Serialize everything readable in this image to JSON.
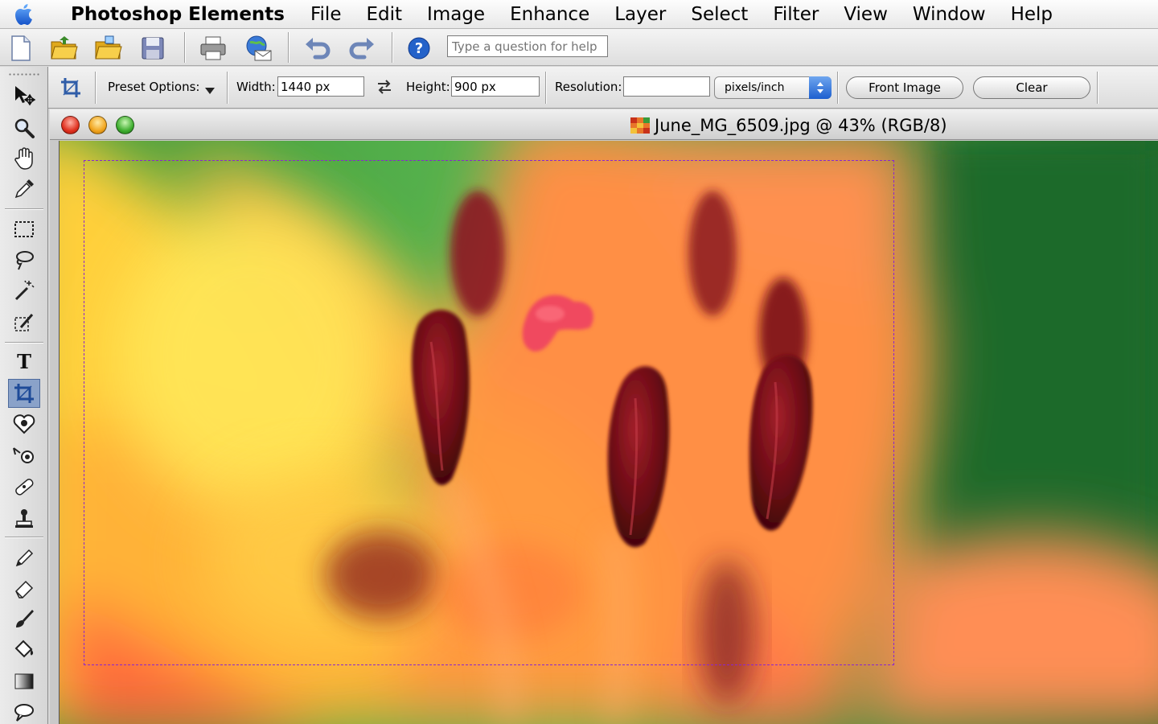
{
  "menubar": {
    "app_name": "Photoshop Elements",
    "menus": [
      "File",
      "Edit",
      "Image",
      "Enhance",
      "Layer",
      "Select",
      "Filter",
      "View",
      "Window",
      "Help"
    ]
  },
  "shortcuts": {
    "help_placeholder": "Type a question for help",
    "icons": [
      "new-file-icon",
      "open-file-icon",
      "browse-folder-icon",
      "save-icon",
      "print-icon",
      "email-icon",
      "undo-icon",
      "redo-icon",
      "help-icon"
    ]
  },
  "options": {
    "preset_label": "Preset Options:",
    "width_label": "Width:",
    "width_value": "1440 px",
    "height_label": "Height:",
    "height_value": "900 px",
    "resolution_label": "Resolution:",
    "resolution_value": "",
    "units_value": "pixels/inch",
    "front_image_label": "Front Image",
    "clear_label": "Clear"
  },
  "document": {
    "title": "June_MG_6509.jpg @ 43% (RGB/8)"
  },
  "toolbox": {
    "tools": [
      "move-tool-icon",
      "zoom-tool-icon",
      "hand-tool-icon",
      "eyedropper-tool-icon",
      "marquee-tool-icon",
      "lasso-tool-icon",
      "magic-wand-tool-icon",
      "selection-brush-tool-icon",
      "type-tool-icon",
      "crop-tool-icon",
      "red-eye-tool-icon",
      "cookie-cutter-tool-icon",
      "healing-brush-tool-icon",
      "clone-stamp-tool-icon",
      "pencil-tool-icon",
      "eraser-tool-icon",
      "brush-tool-icon",
      "paint-bucket-tool-icon",
      "gradient-tool-icon",
      "shape-tool-icon"
    ],
    "active_tool": "crop-tool-icon"
  },
  "colors": {
    "marquee": "#8a25d0",
    "petal_orange": "#ff9a4a",
    "leaf_green": "#4fb24a",
    "stamen_red": "#7a0d16"
  }
}
